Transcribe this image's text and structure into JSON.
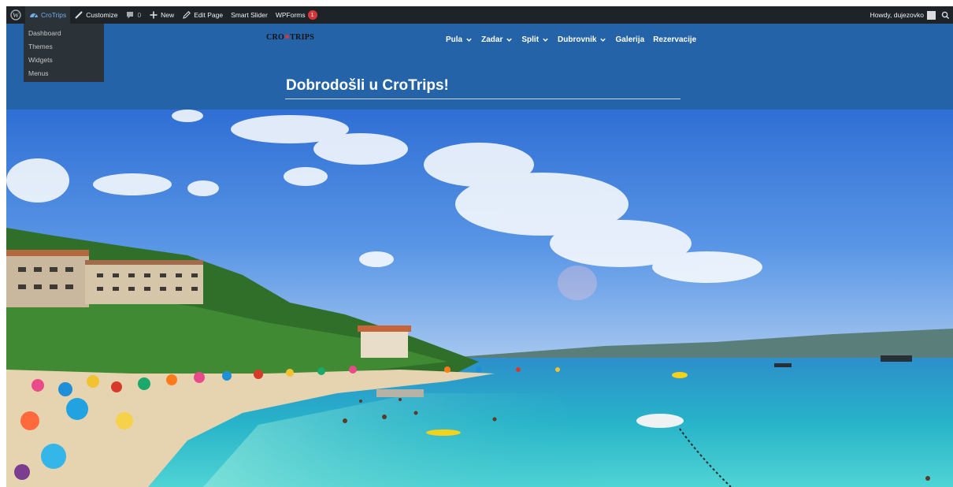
{
  "admin_bar": {
    "wp_logo": "wordpress-icon",
    "site_name": "CroTrips",
    "customize": "Customize",
    "comments_count": "0",
    "new": "New",
    "edit_page": "Edit Page",
    "smart_slider": "Smart Slider",
    "wpforms": "WPForms",
    "wpforms_badge": "1",
    "howdy": "Howdy, dujezovko"
  },
  "site_menu": {
    "items": [
      {
        "label": "Dashboard"
      },
      {
        "label": "Themes"
      },
      {
        "label": "Widgets"
      },
      {
        "label": "Menus"
      }
    ]
  },
  "header": {
    "logo_left": "CRO",
    "logo_right": "TRIPS",
    "nav": [
      {
        "label": "Pula",
        "dropdown": true
      },
      {
        "label": "Zadar",
        "dropdown": true
      },
      {
        "label": "Split",
        "dropdown": true
      },
      {
        "label": "Dubrovnik",
        "dropdown": true
      },
      {
        "label": "Galerija",
        "dropdown": false
      },
      {
        "label": "Rezervacije",
        "dropdown": false
      }
    ],
    "title": "Dobrodošli u CroTrips!"
  },
  "colors": {
    "admin_bar": "#1d2327",
    "header_blue": "#2563a8",
    "accent_red": "#d63638"
  }
}
